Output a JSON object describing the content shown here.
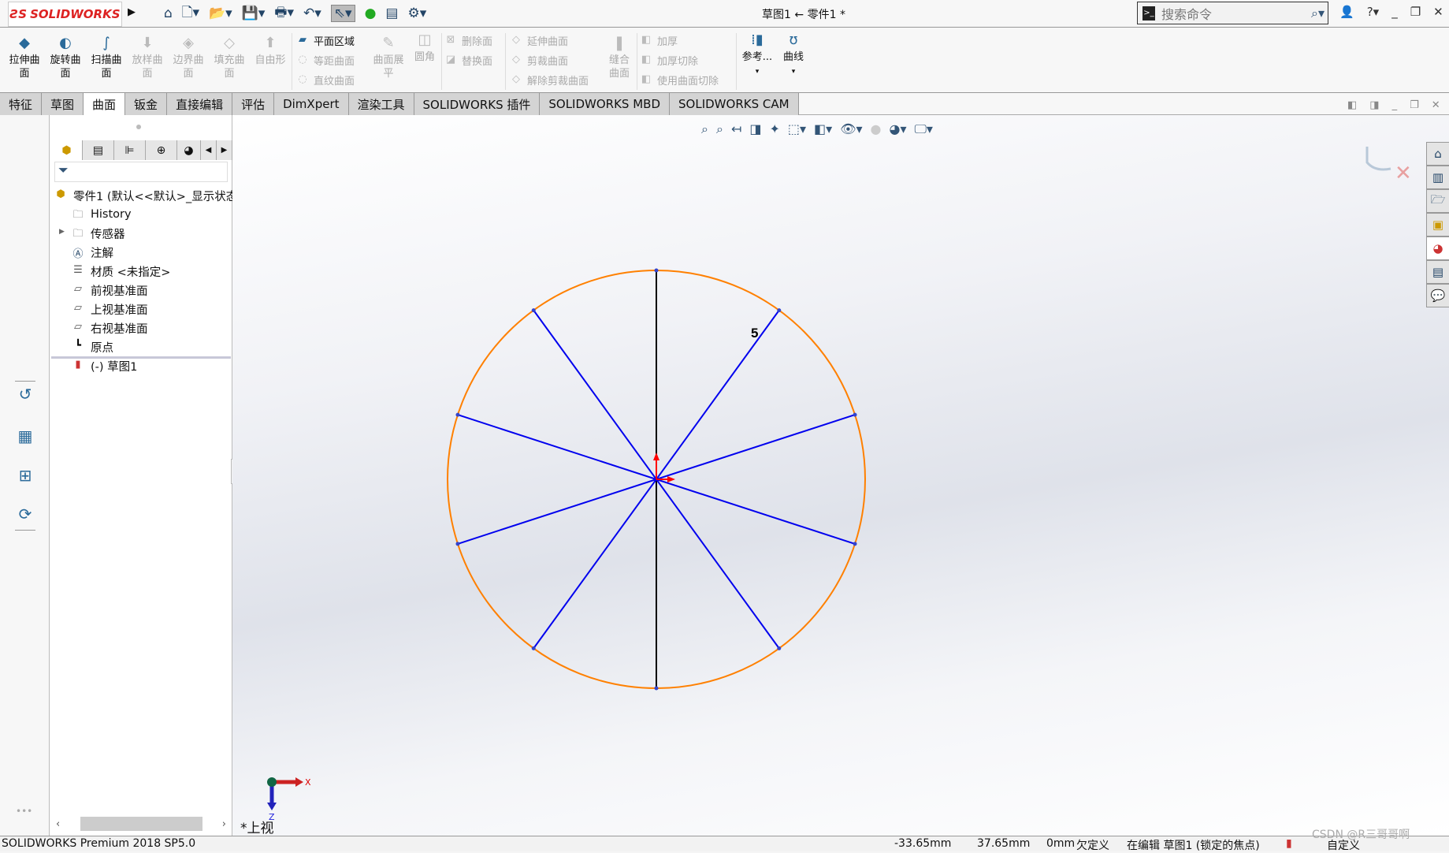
{
  "app": {
    "logo": "SOLIDWORKS",
    "title": "草图1 ← 零件1 *",
    "search_placeholder": "搜索命令"
  },
  "quick_access": [
    "home-icon",
    "new-icon",
    "open-icon",
    "save-icon",
    "print-icon",
    "undo-icon",
    "select-icon",
    "rebuild-icon",
    "file-properties-icon",
    "options-icon"
  ],
  "ribbon": {
    "big": [
      {
        "label": "拉伸曲面",
        "enabled": true
      },
      {
        "label": "旋转曲面",
        "enabled": true
      },
      {
        "label": "扫描曲面",
        "enabled": true
      },
      {
        "label": "放样曲面",
        "enabled": false
      },
      {
        "label": "边界曲面",
        "enabled": false
      },
      {
        "label": "填充曲面",
        "enabled": false
      },
      {
        "label": "自由形",
        "enabled": false
      }
    ],
    "col1": [
      {
        "label": "平面区域",
        "enabled": true
      },
      {
        "label": "等距曲面",
        "enabled": false
      },
      {
        "label": "直纹曲面",
        "enabled": false
      }
    ],
    "flatten": "曲面展平",
    "fillet": "圆角",
    "col2": [
      {
        "label": "删除面"
      },
      {
        "label": "替换面"
      }
    ],
    "col3": [
      {
        "label": "延伸曲面"
      },
      {
        "label": "剪裁曲面"
      },
      {
        "label": "解除剪裁曲面"
      }
    ],
    "knit": "缝合曲面",
    "col4": [
      {
        "label": "加厚"
      },
      {
        "label": "加厚切除"
      },
      {
        "label": "使用曲面切除"
      }
    ],
    "ref": "参考...",
    "curves": "曲线"
  },
  "tabs": [
    "特征",
    "草图",
    "曲面",
    "钣金",
    "直接编辑",
    "评估",
    "DimXpert",
    "渲染工具",
    "SOLIDWORKS 插件",
    "SOLIDWORKS MBD",
    "SOLIDWORKS CAM"
  ],
  "active_tab": "曲面",
  "tree": {
    "root": "零件1  (默认<<默认>_显示状态",
    "items": [
      "History",
      "传感器",
      "注解",
      "材质 <未指定>",
      "前视基准面",
      "上视基准面",
      "右视基准面",
      "原点",
      "(-) 草图1"
    ]
  },
  "sketch": {
    "dimension": "5",
    "segments": 10,
    "colors": {
      "circle": "#ff8000",
      "lines": "#0000ee",
      "centerline": "#000000"
    }
  },
  "triad": {
    "x": "X",
    "z": "Z",
    "view": "*上视"
  },
  "status": {
    "product": "SOLIDWORKS Premium 2018 SP5.0",
    "x": "-33.65mm",
    "y": "37.65mm",
    "z": "0mm",
    "state": "欠定义",
    "mode": "在编辑 草图1 (锁定的焦点)",
    "units": "自定义"
  },
  "watermark": "CSDN @R三哥哥啊"
}
